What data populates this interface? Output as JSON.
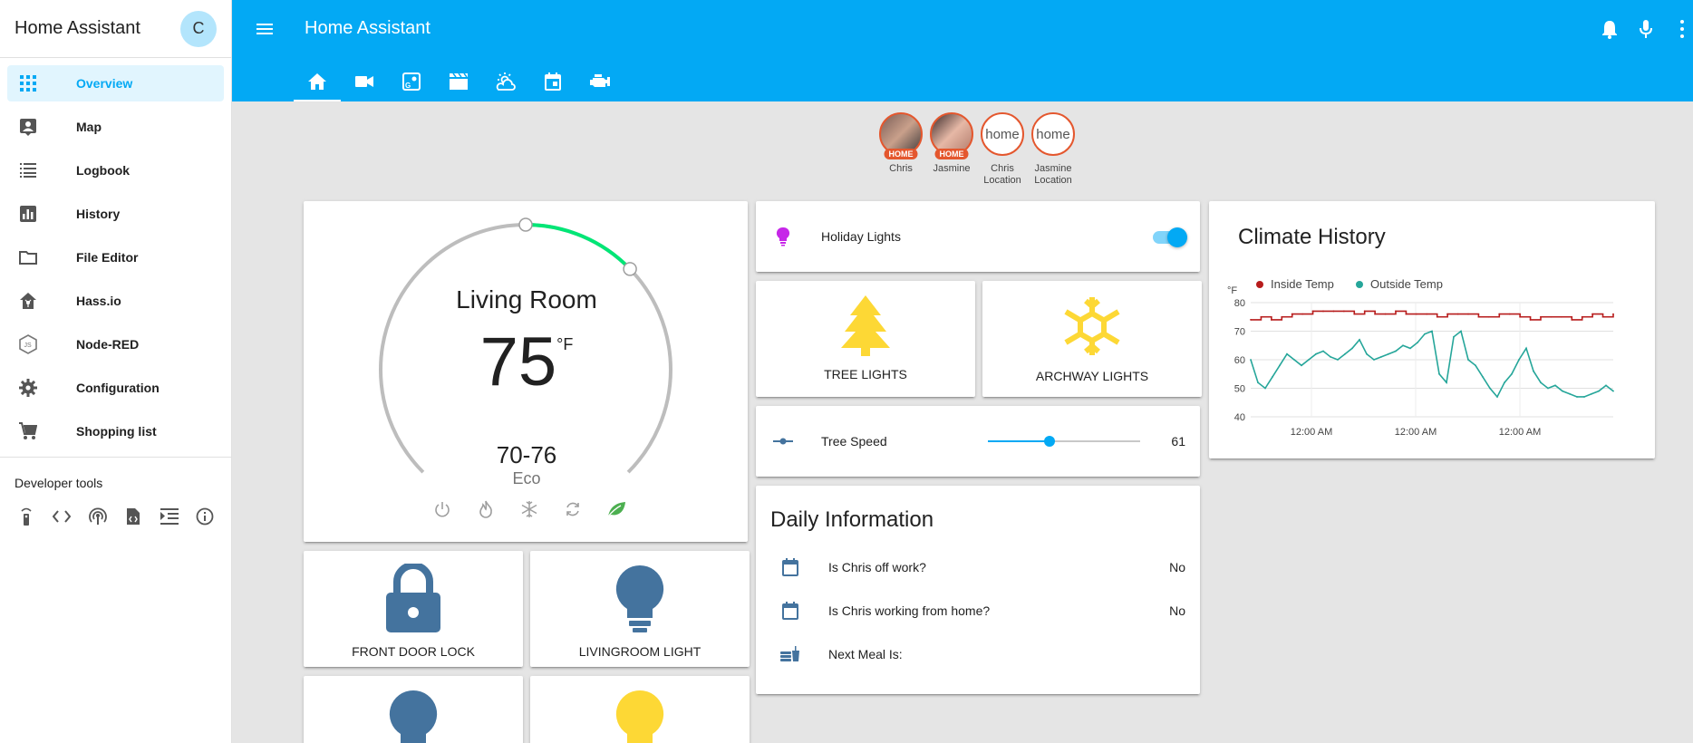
{
  "sidebar": {
    "title": "Home Assistant",
    "avatar_initial": "C",
    "items": [
      {
        "label": "Overview",
        "icon": "grid-icon",
        "active": true
      },
      {
        "label": "Map",
        "icon": "map-account-icon"
      },
      {
        "label": "Logbook",
        "icon": "list-icon"
      },
      {
        "label": "History",
        "icon": "chart-bar-icon"
      },
      {
        "label": "File Editor",
        "icon": "folder-icon"
      },
      {
        "label": "Hass.io",
        "icon": "hassio-icon"
      },
      {
        "label": "Node-RED",
        "icon": "nodejs-icon"
      },
      {
        "label": "Configuration",
        "icon": "gear-icon"
      },
      {
        "label": "Shopping list",
        "icon": "cart-icon"
      }
    ],
    "dev_tools_title": "Developer tools",
    "dev_tools": [
      "remote-icon",
      "code-icon",
      "broadcast-icon",
      "file-code-icon",
      "indent-icon",
      "info-icon"
    ]
  },
  "header": {
    "title": "Home Assistant",
    "tabs": [
      "home-icon",
      "video-camera-icon",
      "google-maps-icon",
      "movie-clapper-icon",
      "weather-icon",
      "calendar-icon",
      "engine-icon"
    ],
    "right_icons": [
      "bell-icon",
      "microphone-icon"
    ]
  },
  "badges": [
    {
      "name": "Chris",
      "state": "HOME",
      "photo": true
    },
    {
      "name": "Jasmine",
      "state": "HOME",
      "photo": true
    },
    {
      "name": "Chris Location",
      "state": "home",
      "photo": false
    },
    {
      "name": "Jasmine Location",
      "state": "home",
      "photo": false
    }
  ],
  "thermostat": {
    "name": "Living Room",
    "current_temp": "75",
    "unit": "°F",
    "range": "70-76",
    "mode": "Eco",
    "low_setpoint": 70,
    "high_setpoint": 76,
    "modes": [
      "power-icon",
      "fire-icon",
      "snowflake-icon",
      "autorenew-icon",
      "leaf-icon"
    ]
  },
  "holiday_lights": {
    "label": "Holiday Lights",
    "state": "on"
  },
  "tree_lights": {
    "label": "TREE LIGHTS"
  },
  "archway_lights": {
    "label": "ARCHWAY LIGHTS"
  },
  "tree_speed": {
    "label": "Tree Speed",
    "value": "61",
    "min": 0,
    "max": 150
  },
  "front_door": {
    "label": "FRONT DOOR LOCK"
  },
  "livingroom_light": {
    "label": "LIVINGROOM LIGHT"
  },
  "daily": {
    "title": "Daily Information",
    "rows": [
      {
        "label": "Is Chris off work?",
        "value": "No",
        "icon": "calendar-icon"
      },
      {
        "label": "Is Chris working from home?",
        "value": "No",
        "icon": "calendar-icon"
      },
      {
        "label": "Next Meal Is:",
        "value": "",
        "icon": "food-icon"
      }
    ]
  },
  "colors": {
    "accent": "#03a9f4",
    "badge_border": "#e4572e",
    "entity_icon": "#44739e",
    "light_on": "#fdd835",
    "inside_temp": "#b71c1c",
    "outside_temp": "#26a69a",
    "eco_green": "#4caf50",
    "bulb_purple": "#c626e8"
  },
  "chart_data": {
    "type": "line",
    "title": "Climate History",
    "ylabel": "°F",
    "ylim": [
      40,
      80
    ],
    "yticks": [
      "80",
      "70",
      "60",
      "50",
      "40"
    ],
    "xticks": [
      "12:00 AM",
      "12:00 AM",
      "12:00 AM"
    ],
    "legend": "top-left",
    "series": [
      {
        "name": "Inside Temp",
        "color": "#b71c1c",
        "values": [
          74,
          75,
          74,
          75,
          76,
          76,
          77,
          77,
          77,
          77,
          76,
          77,
          76,
          76,
          77,
          76,
          76,
          76,
          75,
          76,
          76,
          76,
          75,
          75,
          76,
          76,
          75,
          74,
          75,
          75,
          75,
          74,
          75,
          76,
          75,
          76
        ]
      },
      {
        "name": "Outside Temp",
        "color": "#26a69a",
        "values": [
          60,
          52,
          50,
          54,
          58,
          62,
          60,
          58,
          60,
          62,
          63,
          61,
          60,
          62,
          64,
          67,
          62,
          60,
          61,
          62,
          63,
          65,
          64,
          66,
          69,
          70,
          55,
          52,
          68,
          70,
          60,
          58,
          54,
          50,
          47,
          52,
          55,
          60,
          64,
          56,
          52,
          50,
          51,
          49,
          48,
          47,
          47,
          48,
          49,
          51,
          49
        ]
      }
    ]
  }
}
